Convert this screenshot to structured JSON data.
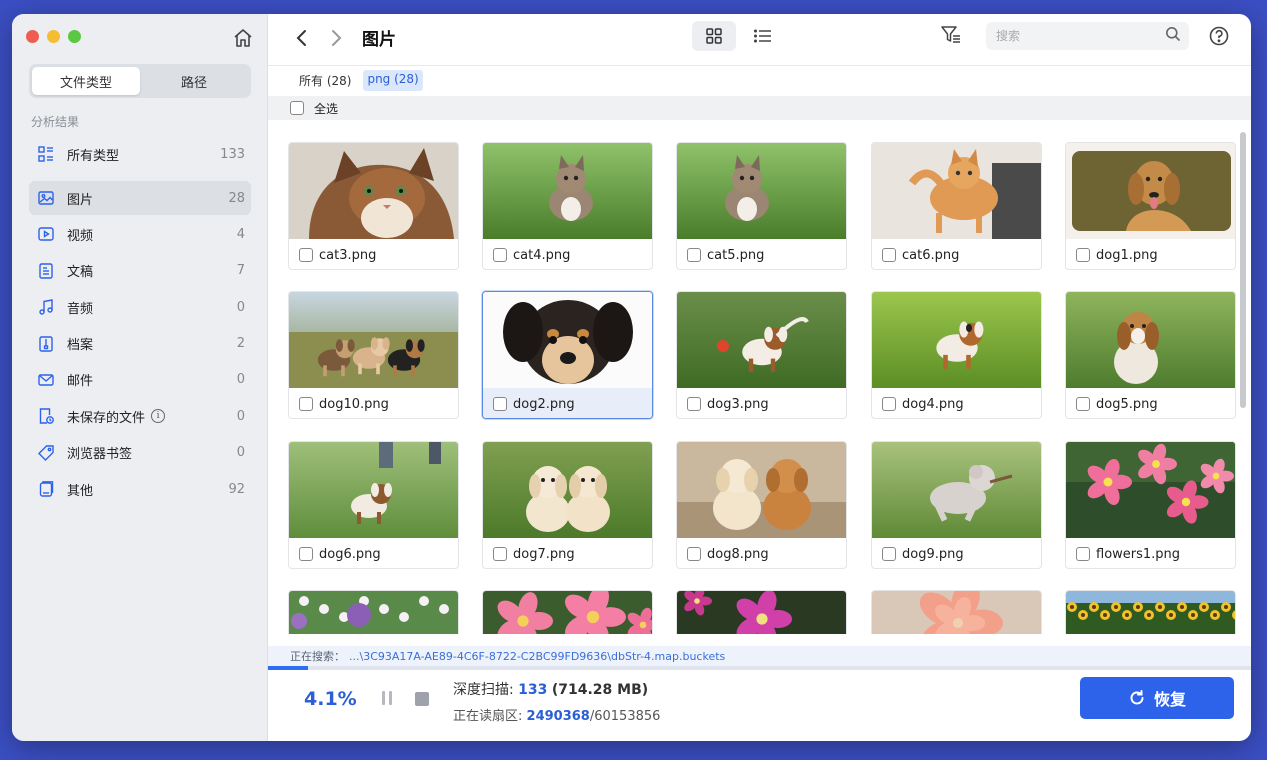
{
  "sidebar": {
    "tabs": [
      {
        "label": "文件类型",
        "active": true
      },
      {
        "label": "路径",
        "active": false
      }
    ],
    "section_label": "分析结果",
    "items": [
      {
        "label": "所有类型",
        "count": "133",
        "icon": "grid-list-icon"
      },
      {
        "label": "图片",
        "count": "28",
        "icon": "image-icon"
      },
      {
        "label": "视频",
        "count": "4",
        "icon": "video-icon"
      },
      {
        "label": "文稿",
        "count": "7",
        "icon": "document-icon"
      },
      {
        "label": "音频",
        "count": "0",
        "icon": "music-icon"
      },
      {
        "label": "档案",
        "count": "2",
        "icon": "archive-icon"
      },
      {
        "label": "邮件",
        "count": "0",
        "icon": "mail-icon"
      },
      {
        "label": "未保存的文件",
        "count": "0",
        "icon": "unsaved-file-icon"
      },
      {
        "label": "浏览器书签",
        "count": "0",
        "icon": "tag-icon"
      },
      {
        "label": "其他",
        "count": "92",
        "icon": "other-icon"
      }
    ],
    "active_index": 1
  },
  "toolbar": {
    "title": "图片",
    "search_placeholder": "搜索"
  },
  "filter": {
    "tags": [
      {
        "label": "所有 (28)",
        "active": false
      },
      {
        "label": "png (28)",
        "active": true
      }
    ],
    "select_all_label": "全选"
  },
  "files": [
    {
      "name": "cat3.png",
      "thumb": "cat"
    },
    {
      "name": "cat4.png",
      "thumb": "kitten-grass"
    },
    {
      "name": "cat5.png",
      "thumb": "kitten-grass2"
    },
    {
      "name": "cat6.png",
      "thumb": "cat-orange"
    },
    {
      "name": "dog1.png",
      "thumb": "dog-golden"
    },
    {
      "name": "dog10.png",
      "thumb": "puppies-three"
    },
    {
      "name": "dog2.png",
      "thumb": "puppy-face",
      "selected": true
    },
    {
      "name": "dog3.png",
      "thumb": "beagle-ball"
    },
    {
      "name": "dog4.png",
      "thumb": "beagle-run"
    },
    {
      "name": "dog5.png",
      "thumb": "beagle-sit"
    },
    {
      "name": "dog6.png",
      "thumb": "puppy-run"
    },
    {
      "name": "dog7.png",
      "thumb": "labs-two"
    },
    {
      "name": "dog8.png",
      "thumb": "labs-two2"
    },
    {
      "name": "dog9.png",
      "thumb": "poodle-run"
    },
    {
      "name": "flowers1.png",
      "thumb": "flowers-pink"
    },
    {
      "name": "",
      "thumb": "flowers-purple"
    },
    {
      "name": "",
      "thumb": "flowers-pink2"
    },
    {
      "name": "",
      "thumb": "flowers-magenta"
    },
    {
      "name": "",
      "thumb": "flower-peach"
    },
    {
      "name": "",
      "thumb": "sunflowers"
    }
  ],
  "status": {
    "searching_prefix": "正在搜索：",
    "searching_path": "...\\3C93A17A-AE89-4C6F-8722-C2BC99FD9636\\dbStr-4.map.buckets",
    "progress_percent": 4.1,
    "progress_label": "4.1%",
    "scan_label": "深度扫描:",
    "scan_count": "133",
    "scan_size": "(714.28 MB)",
    "read_label": "正在读扇区:",
    "read_current": "2490368",
    "read_total": "/60153856"
  },
  "recover_button": {
    "label": "恢复"
  },
  "colors": {
    "accent": "#2d62eb",
    "background": "#3b4fc4",
    "sidebar": "#eceef1"
  }
}
